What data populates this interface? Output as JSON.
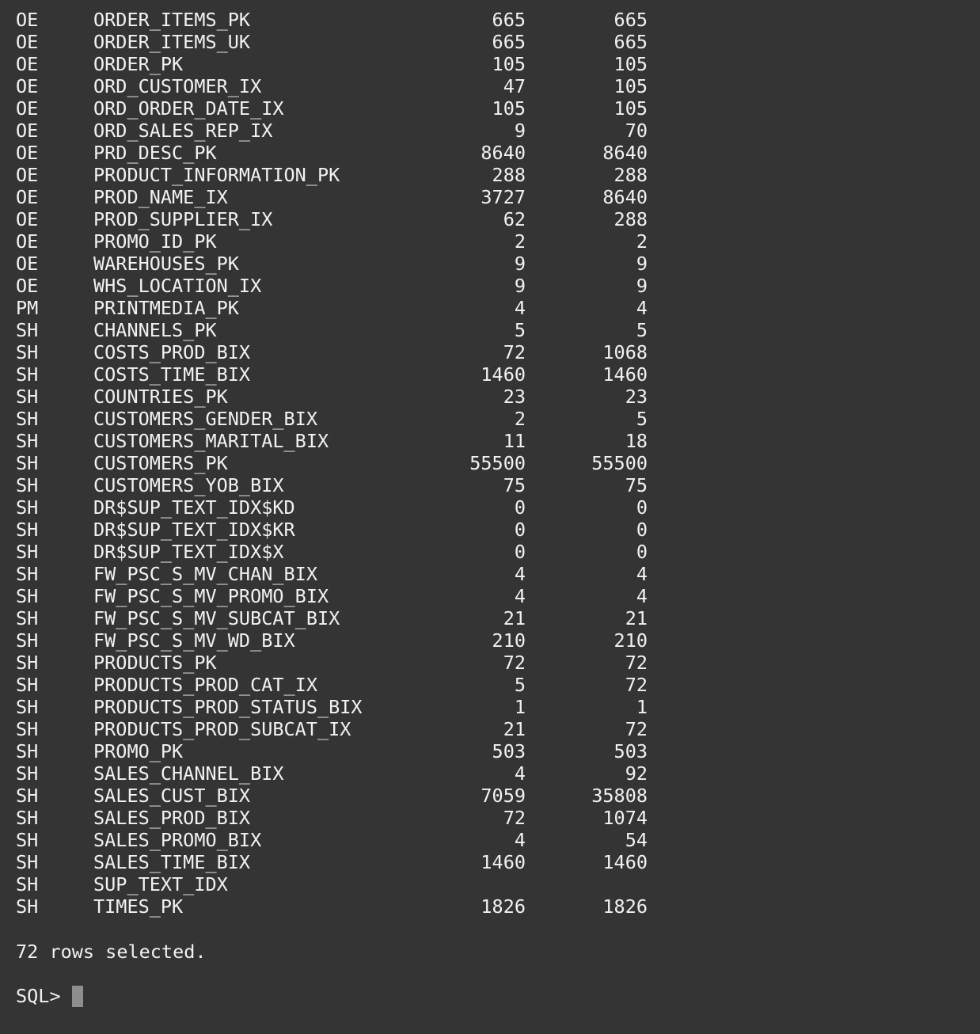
{
  "terminal": {
    "rows": [
      [
        "OE",
        "ORDER_ITEMS_PK",
        "665",
        "665"
      ],
      [
        "OE",
        "ORDER_ITEMS_UK",
        "665",
        "665"
      ],
      [
        "OE",
        "ORDER_PK",
        "105",
        "105"
      ],
      [
        "OE",
        "ORD_CUSTOMER_IX",
        "47",
        "105"
      ],
      [
        "OE",
        "ORD_ORDER_DATE_IX",
        "105",
        "105"
      ],
      [
        "OE",
        "ORD_SALES_REP_IX",
        "9",
        "70"
      ],
      [
        "OE",
        "PRD_DESC_PK",
        "8640",
        "8640"
      ],
      [
        "OE",
        "PRODUCT_INFORMATION_PK",
        "288",
        "288"
      ],
      [
        "OE",
        "PROD_NAME_IX",
        "3727",
        "8640"
      ],
      [
        "OE",
        "PROD_SUPPLIER_IX",
        "62",
        "288"
      ],
      [
        "OE",
        "PROMO_ID_PK",
        "2",
        "2"
      ],
      [
        "OE",
        "WAREHOUSES_PK",
        "9",
        "9"
      ],
      [
        "OE",
        "WHS_LOCATION_IX",
        "9",
        "9"
      ],
      [
        "PM",
        "PRINTMEDIA_PK",
        "4",
        "4"
      ],
      [
        "SH",
        "CHANNELS_PK",
        "5",
        "5"
      ],
      [
        "SH",
        "COSTS_PROD_BIX",
        "72",
        "1068"
      ],
      [
        "SH",
        "COSTS_TIME_BIX",
        "1460",
        "1460"
      ],
      [
        "SH",
        "COUNTRIES_PK",
        "23",
        "23"
      ],
      [
        "SH",
        "CUSTOMERS_GENDER_BIX",
        "2",
        "5"
      ],
      [
        "SH",
        "CUSTOMERS_MARITAL_BIX",
        "11",
        "18"
      ],
      [
        "SH",
        "CUSTOMERS_PK",
        "55500",
        "55500"
      ],
      [
        "SH",
        "CUSTOMERS_YOB_BIX",
        "75",
        "75"
      ],
      [
        "SH",
        "DR$SUP_TEXT_IDX$KD",
        "0",
        "0"
      ],
      [
        "SH",
        "DR$SUP_TEXT_IDX$KR",
        "0",
        "0"
      ],
      [
        "SH",
        "DR$SUP_TEXT_IDX$X",
        "0",
        "0"
      ],
      [
        "SH",
        "FW_PSC_S_MV_CHAN_BIX",
        "4",
        "4"
      ],
      [
        "SH",
        "FW_PSC_S_MV_PROMO_BIX",
        "4",
        "4"
      ],
      [
        "SH",
        "FW_PSC_S_MV_SUBCAT_BIX",
        "21",
        "21"
      ],
      [
        "SH",
        "FW_PSC_S_MV_WD_BIX",
        "210",
        "210"
      ],
      [
        "SH",
        "PRODUCTS_PK",
        "72",
        "72"
      ],
      [
        "SH",
        "PRODUCTS_PROD_CAT_IX",
        "5",
        "72"
      ],
      [
        "SH",
        "PRODUCTS_PROD_STATUS_BIX",
        "1",
        "1"
      ],
      [
        "SH",
        "PRODUCTS_PROD_SUBCAT_IX",
        "21",
        "72"
      ],
      [
        "SH",
        "PROMO_PK",
        "503",
        "503"
      ],
      [
        "SH",
        "SALES_CHANNEL_BIX",
        "4",
        "92"
      ],
      [
        "SH",
        "SALES_CUST_BIX",
        "7059",
        "35808"
      ],
      [
        "SH",
        "SALES_PROD_BIX",
        "72",
        "1074"
      ],
      [
        "SH",
        "SALES_PROMO_BIX",
        "4",
        "54"
      ],
      [
        "SH",
        "SALES_TIME_BIX",
        "1460",
        "1460"
      ],
      [
        "SH",
        "SUP_TEXT_IDX",
        "",
        ""
      ],
      [
        "SH",
        "TIMES_PK",
        "1826",
        "1826"
      ]
    ],
    "footer": "72 rows selected.",
    "prompt": "SQL>"
  }
}
